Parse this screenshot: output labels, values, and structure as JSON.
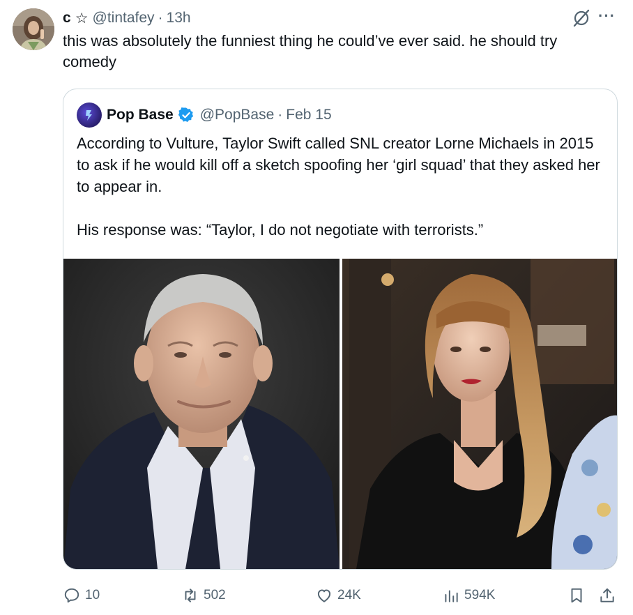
{
  "tweet": {
    "author_name": "c",
    "author_icon": "star-outline-icon",
    "handle": "@tintafey",
    "separator": "·",
    "time": "13h",
    "text": "this was absolutely the funniest thing he could’ve ever said. he should try comedy"
  },
  "quoted": {
    "author_name": "Pop Base",
    "handle": "@PopBase",
    "separator": "·",
    "date": "Feb 15",
    "paragraphs": [
      "According to Vulture, Taylor Swift called SNL creator Lorne Michaels in 2015 to ask if he would kill off a sketch spoofing her ‘girl squad’ that they asked her to appear in.",
      "His response was: “Taylor, I do not negotiate with terrorists.”"
    ],
    "verified_color": "#1d9bf0"
  },
  "metrics": {
    "replies": "10",
    "retweets": "502",
    "likes": "24K",
    "views": "594K"
  },
  "colors": {
    "text": "#0f1419",
    "muted": "#536471",
    "border": "#cfd9de"
  }
}
